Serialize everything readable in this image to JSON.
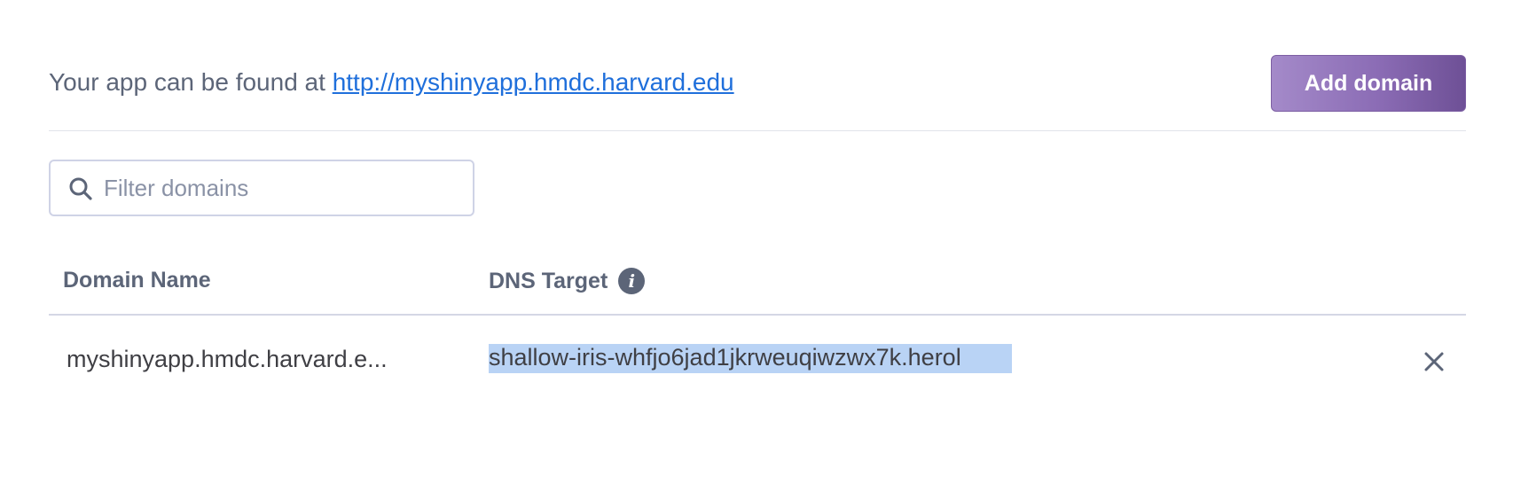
{
  "header": {
    "intro_text": "Your app can be found at ",
    "app_url": "http://myshinyapp.hmdc.harvard.edu",
    "add_domain_label": "Add domain"
  },
  "filter": {
    "placeholder": "Filter domains",
    "value": "",
    "icon": "search-icon"
  },
  "table": {
    "columns": {
      "domain_name": "Domain Name",
      "dns_target": "DNS Target",
      "dns_target_info_icon": "i"
    },
    "rows": [
      {
        "domain_name": "myshinyapp.hmdc.harvard.e...",
        "dns_target": "shallow-iris-whfjo6jad1jkrweuqiwzwx7k.herol",
        "remove_icon": "close-icon"
      }
    ]
  },
  "colors": {
    "link": "#1f6fdb",
    "button_start": "#a48ac9",
    "button_end": "#6e5096",
    "selection": "#b9d3f5",
    "muted_text": "#5c6578"
  }
}
